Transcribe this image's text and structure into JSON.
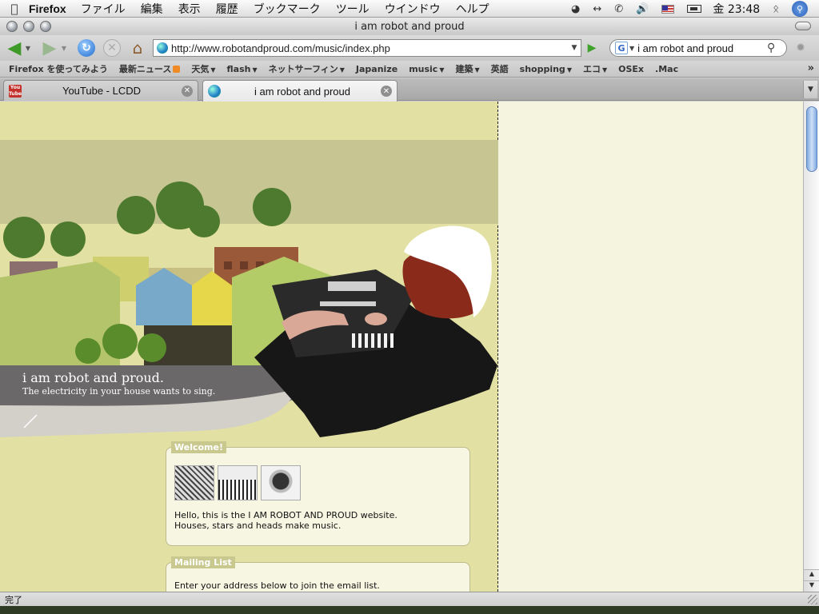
{
  "menubar": {
    "apple": "",
    "app": "Firefox",
    "items": [
      "ファイル",
      "編集",
      "表示",
      "履歴",
      "ブックマーク",
      "ツール",
      "ウインドウ",
      "ヘルプ"
    ],
    "clock": "金 23:48"
  },
  "window": {
    "title": "i am robot and proud"
  },
  "toolbar": {
    "url": "http://www.robotandproud.com/music/index.php",
    "search_value": "i am robot and proud",
    "search_engine": "G"
  },
  "bookmarks": [
    {
      "label": "Firefox を使ってみよう",
      "dropdown": false
    },
    {
      "label": "最新ニュース",
      "dropdown": false,
      "rss": true
    },
    {
      "label": "天気",
      "dropdown": true
    },
    {
      "label": "flash",
      "dropdown": true
    },
    {
      "label": "ネットサーフィン",
      "dropdown": true
    },
    {
      "label": "Japanize",
      "dropdown": false
    },
    {
      "label": "music",
      "dropdown": true
    },
    {
      "label": "建築",
      "dropdown": true
    },
    {
      "label": "英語",
      "dropdown": false
    },
    {
      "label": "shopping",
      "dropdown": true
    },
    {
      "label": "エコ",
      "dropdown": true
    },
    {
      "label": "OSEx",
      "dropdown": false
    },
    {
      "label": ".Mac",
      "dropdown": false
    }
  ],
  "tabs": [
    {
      "title": "YouTube - LCDD",
      "icon_text": "You Tube",
      "active": false
    },
    {
      "title": "i am robot and proud",
      "active": true
    }
  ],
  "page": {
    "hero_title": "i am robot and proud.",
    "hero_subtitle": "The electricity in your house wants to sing.",
    "welcome": {
      "label": "Welcome!",
      "line1": "Hello, this is the I AM ROBOT AND PROUD website.",
      "line2": "Houses, stars and heads make music."
    },
    "mailing": {
      "label": "Mailing List",
      "text": "Enter your address below to join the email list."
    }
  },
  "status": {
    "text": "完了"
  },
  "colors": {
    "page_left": "#e2e1a3",
    "page_right": "#f4f4df",
    "box_label": "#c9c88e"
  }
}
